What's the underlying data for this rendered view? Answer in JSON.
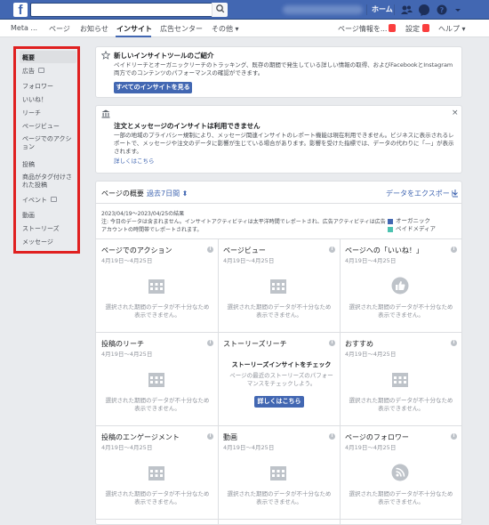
{
  "topbar": {
    "logo": "f",
    "home": "ホーム"
  },
  "subnav": {
    "meta": "Meta ...",
    "page": "ページ",
    "notifications": "お知らせ",
    "insights": "インサイト",
    "ad_center": "広告センター",
    "more": "その他",
    "page_info": "ページ情報を...",
    "settings": "設定",
    "help": "ヘルプ"
  },
  "sidebar": {
    "items": [
      "概要",
      "広告",
      "フォロワー",
      "いいね！",
      "リーチ",
      "ページビュー",
      "ページでのアクション",
      "投稿",
      "商品がタグ付けされた投稿",
      "イベント",
      "動画",
      "ストーリーズ",
      "メッセージ"
    ]
  },
  "intro": {
    "title": "新しいインサイトツールのご紹介",
    "body": "ペイドリーチとオーガニックリーチのトラッキング、既存の期間で発生している詳しい情報の取得、およびFacebookとInstagram両方でのコンテンツのパフォーマンスの確認ができます。",
    "button": "すべてのインサイトを見る"
  },
  "notice": {
    "title": "注文とメッセージのインサイトは利用できません",
    "body": "一部の地域のプライバシー規制により、メッセージ関連インサイトのレポート機能は現在利用できません。ビジネスに表示されるレポートで、メッセージや注文のデータに影響が生じている場合があります。影響を受けた指標では、データの代わりに「—」が表示されます。",
    "link": "詳しくはこちら",
    "close": "×"
  },
  "overview": {
    "title": "ページの概要",
    "range": "過去7日間",
    "export": "データをエクスポート",
    "date_range": "2023/04/19～2023/04/25の結果",
    "note": "注: 今日のデータは含まれません。インサイトアクティビティは太平洋時間でレポートされ、広告アクティビティは広告アカウントの時間帯でレポートされます。",
    "legend": [
      {
        "label": "オーガニック",
        "color": "#4267b2"
      },
      {
        "label": "ペイドメディア",
        "color": "#4cc2b0"
      }
    ]
  },
  "tiles": [
    {
      "title": "ページでのアクション",
      "date": "4月19日～4月25日",
      "msg": "選択された期間のデータが不十分なため表示できません。",
      "icon": "calendar-icon"
    },
    {
      "title": "ページビュー",
      "date": "4月19日～4月25日",
      "msg": "選択された期間のデータが不十分なため表示できません。",
      "icon": "calendar-icon"
    },
    {
      "title": "ページへの「いいね！」",
      "date": "4月19日～4月25日",
      "msg": "選択された期間のデータが不十分なため表示できません。",
      "icon": "like-icon"
    },
    {
      "title": "投稿のリーチ",
      "date": "4月19日～4月25日",
      "msg": "選択された期間のデータが不十分なため表示できません。",
      "icon": "calendar-icon"
    },
    {
      "title": "ストーリーズリーチ",
      "subtitle": "ストーリーズインサイトをチェック",
      "msg": "ページの最近のストーリーズのパフォーマンスをチェックしよう。",
      "button": "詳しくはこちら"
    },
    {
      "title": "おすすめ",
      "date": "4月19日～4月25日",
      "msg": "選択された期間のデータが不十分なため表示できません。",
      "icon": "calendar-icon"
    },
    {
      "title": "投稿のエンゲージメント",
      "date": "4月19日～4月25日",
      "msg": "選択された期間のデータが不十分なため表示できません。",
      "icon": "calendar-icon"
    },
    {
      "title": "動画",
      "date": "4月19日～4月25日",
      "msg": "選択された期間のデータが不十分なため表示できません。",
      "icon": "calendar-icon"
    },
    {
      "title": "ページのフォロワー",
      "date": "4月19日～4月25日",
      "msg": "選択された期間のデータが不十分なため表示できません。",
      "icon": "rss-icon"
    }
  ]
}
